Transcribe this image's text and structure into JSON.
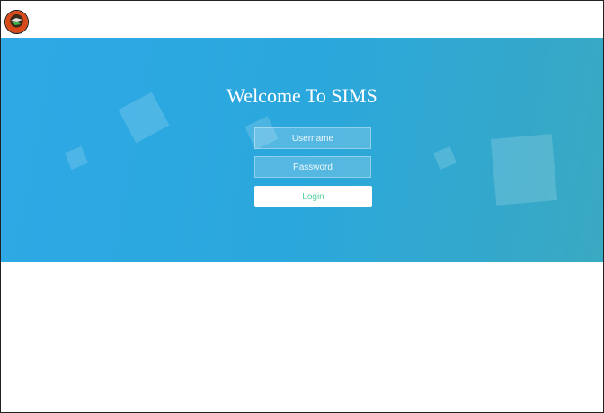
{
  "header": {
    "logo_icon": "sims-logo-icon"
  },
  "hero": {
    "title": "Welcome To SIMS",
    "background_colors": [
      "#2fa9e6",
      "#3aa9c2"
    ]
  },
  "form": {
    "username_placeholder": "Username",
    "username_value": "",
    "password_placeholder": "Password",
    "password_value": "",
    "login_label": "Login",
    "login_text_color": "#52d19a"
  }
}
